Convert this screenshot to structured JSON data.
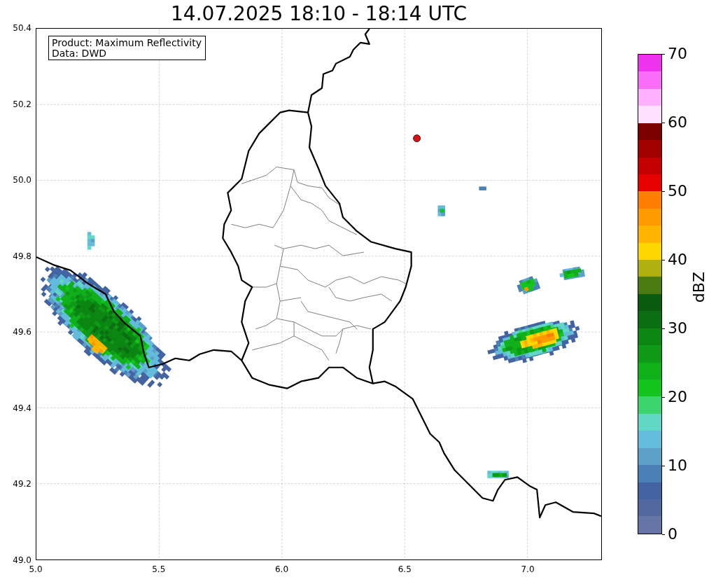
{
  "title": "14.07.2025 18:10 - 18:14 UTC",
  "map": {
    "info_lines": [
      "Product: Maximum Reflectivity",
      "Data: DWD"
    ],
    "y_ticks": [
      "50.4",
      "50.2",
      "50.0",
      "49.8",
      "49.6",
      "49.4",
      "49.2",
      "49.0"
    ],
    "x_ticks": [
      "5.0",
      "5.5",
      "6.0",
      "6.5",
      "7.0"
    ]
  },
  "colorbar": {
    "label": "dBZ",
    "ticks": [
      "70",
      "60",
      "50",
      "40",
      "30",
      "20",
      "10",
      "0"
    ],
    "steps": [
      {
        "color": "#ee33ee"
      },
      {
        "color": "#f86ef6"
      },
      {
        "color": "#ffb0ff"
      },
      {
        "color": "#ffe0ff"
      },
      {
        "color": "#7a0000"
      },
      {
        "color": "#a00000"
      },
      {
        "color": "#c40000"
      },
      {
        "color": "#e60000"
      },
      {
        "color": "#ff7f00"
      },
      {
        "color": "#ff9a00"
      },
      {
        "color": "#ffb400"
      },
      {
        "color": "#ffd700"
      },
      {
        "color": "#b0b010"
      },
      {
        "color": "#4a7a10"
      },
      {
        "color": "#0a5a10"
      },
      {
        "color": "#0c6e12"
      },
      {
        "color": "#0c8612"
      },
      {
        "color": "#0e9a16"
      },
      {
        "color": "#10b01a"
      },
      {
        "color": "#14c41e"
      },
      {
        "color": "#3cd46c"
      },
      {
        "color": "#60d8c8"
      },
      {
        "color": "#64bcdc"
      },
      {
        "color": "#5ca0c8"
      },
      {
        "color": "#4a80b4"
      },
      {
        "color": "#4262a2"
      },
      {
        "color": "#52689e"
      },
      {
        "color": "#6474a4"
      }
    ]
  }
}
